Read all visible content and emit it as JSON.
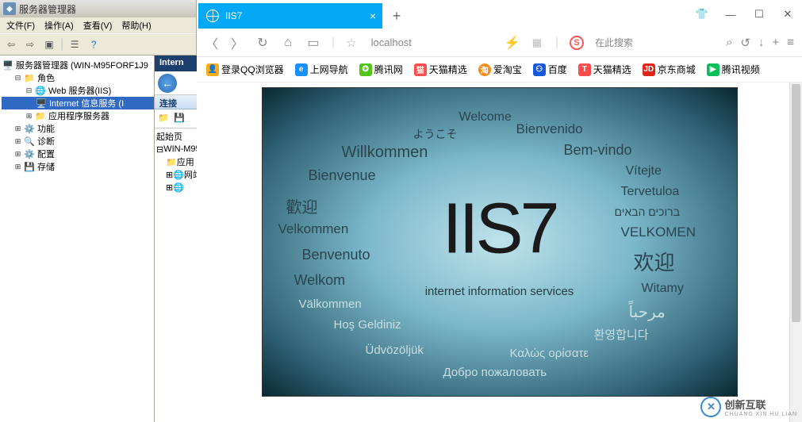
{
  "server_manager": {
    "title": "服务器管理器",
    "menu": {
      "file": "文件(F)",
      "action": "操作(A)",
      "view": "查看(V)",
      "help": "帮助(H)"
    },
    "tree": {
      "root": "服务器管理器 (WIN-M95FORF1J9",
      "roles": "角色",
      "web_server": "Web 服务器(IIS)",
      "iis_service": "Internet 信息服务 (I",
      "app_server": "应用程序服务器",
      "features": "功能",
      "diagnostics": "诊断",
      "config": "配置",
      "storage": "存储"
    }
  },
  "iis_panel": {
    "header": "Intern",
    "connections": "连接",
    "start_page": "起始页",
    "server_node": "WIN-M95",
    "app_pools": "应用",
    "sites": "网站"
  },
  "browser": {
    "tab_title": "IIS7",
    "url": "localhost",
    "search_placeholder": "在此搜索",
    "bookmarks": {
      "qq_login": "登录QQ浏览器",
      "nav": "上网导航",
      "tencent": "腾讯网",
      "tmall": "天猫精选",
      "aitaobao": "爱淘宝",
      "baidu": "百度",
      "tmall2": "天猫精选",
      "jd": "京东商城",
      "tencent_video": "腾讯视频"
    }
  },
  "iis_welcome": {
    "big": "IIS7",
    "sub": "internet information services",
    "words": {
      "welcome": "Welcome",
      "bienvenido": "Bienvenido",
      "youkoso": "ようこそ",
      "bemvindo": "Bem-vindo",
      "willkommen": "Willkommen",
      "vitejte": "Vítejte",
      "bienvenue": "Bienvenue",
      "tervetuloa": "Tervetuloa",
      "huanying_tc": "歡迎",
      "hebrew": "ברוכים הבאים",
      "velkommen": "Velkommen",
      "velkomen_caps": "VELKOMEN",
      "benvenuto": "Benvenuto",
      "huanying_sc": "欢迎",
      "welkom": "Welkom",
      "witamy": "Witamy",
      "valkommen": "Välkommen",
      "arabic": "مرحباً",
      "hos": "Hoş Geldiniz",
      "korean": "환영합니다",
      "udvozoljuk": "Üdvözöljük",
      "greek": "Καλώς ορίσατε",
      "russian": "Добро пожаловать"
    }
  },
  "watermark": {
    "text": "创新互联",
    "sub": "CHUANG XIN HU LIAN"
  }
}
